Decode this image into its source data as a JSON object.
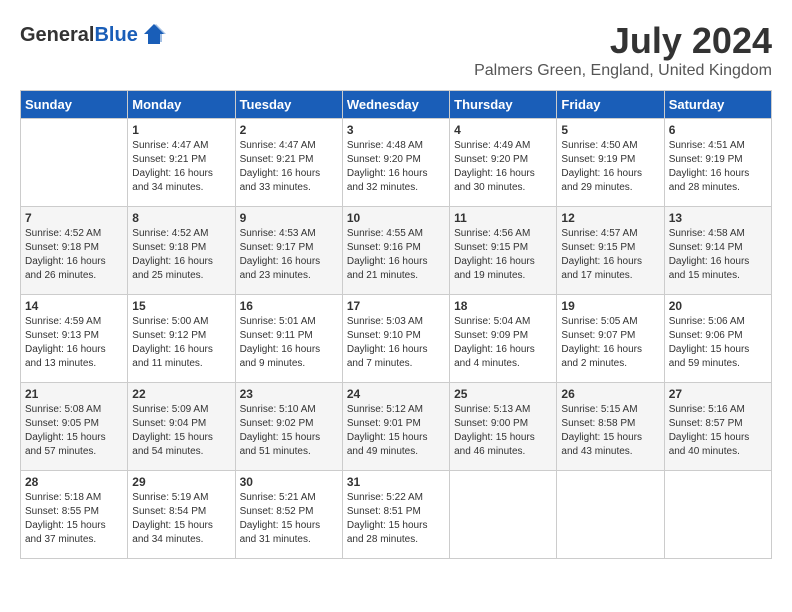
{
  "header": {
    "logo_general": "General",
    "logo_blue": "Blue",
    "month_year": "July 2024",
    "location": "Palmers Green, England, United Kingdom"
  },
  "calendar": {
    "days_of_week": [
      "Sunday",
      "Monday",
      "Tuesday",
      "Wednesday",
      "Thursday",
      "Friday",
      "Saturday"
    ],
    "weeks": [
      [
        {
          "day": "",
          "sunrise": "",
          "sunset": "",
          "daylight": ""
        },
        {
          "day": "1",
          "sunrise": "Sunrise: 4:47 AM",
          "sunset": "Sunset: 9:21 PM",
          "daylight": "Daylight: 16 hours and 34 minutes."
        },
        {
          "day": "2",
          "sunrise": "Sunrise: 4:47 AM",
          "sunset": "Sunset: 9:21 PM",
          "daylight": "Daylight: 16 hours and 33 minutes."
        },
        {
          "day": "3",
          "sunrise": "Sunrise: 4:48 AM",
          "sunset": "Sunset: 9:20 PM",
          "daylight": "Daylight: 16 hours and 32 minutes."
        },
        {
          "day": "4",
          "sunrise": "Sunrise: 4:49 AM",
          "sunset": "Sunset: 9:20 PM",
          "daylight": "Daylight: 16 hours and 30 minutes."
        },
        {
          "day": "5",
          "sunrise": "Sunrise: 4:50 AM",
          "sunset": "Sunset: 9:19 PM",
          "daylight": "Daylight: 16 hours and 29 minutes."
        },
        {
          "day": "6",
          "sunrise": "Sunrise: 4:51 AM",
          "sunset": "Sunset: 9:19 PM",
          "daylight": "Daylight: 16 hours and 28 minutes."
        }
      ],
      [
        {
          "day": "7",
          "sunrise": "Sunrise: 4:52 AM",
          "sunset": "Sunset: 9:18 PM",
          "daylight": "Daylight: 16 hours and 26 minutes."
        },
        {
          "day": "8",
          "sunrise": "Sunrise: 4:52 AM",
          "sunset": "Sunset: 9:18 PM",
          "daylight": "Daylight: 16 hours and 25 minutes."
        },
        {
          "day": "9",
          "sunrise": "Sunrise: 4:53 AM",
          "sunset": "Sunset: 9:17 PM",
          "daylight": "Daylight: 16 hours and 23 minutes."
        },
        {
          "day": "10",
          "sunrise": "Sunrise: 4:55 AM",
          "sunset": "Sunset: 9:16 PM",
          "daylight": "Daylight: 16 hours and 21 minutes."
        },
        {
          "day": "11",
          "sunrise": "Sunrise: 4:56 AM",
          "sunset": "Sunset: 9:15 PM",
          "daylight": "Daylight: 16 hours and 19 minutes."
        },
        {
          "day": "12",
          "sunrise": "Sunrise: 4:57 AM",
          "sunset": "Sunset: 9:15 PM",
          "daylight": "Daylight: 16 hours and 17 minutes."
        },
        {
          "day": "13",
          "sunrise": "Sunrise: 4:58 AM",
          "sunset": "Sunset: 9:14 PM",
          "daylight": "Daylight: 16 hours and 15 minutes."
        }
      ],
      [
        {
          "day": "14",
          "sunrise": "Sunrise: 4:59 AM",
          "sunset": "Sunset: 9:13 PM",
          "daylight": "Daylight: 16 hours and 13 minutes."
        },
        {
          "day": "15",
          "sunrise": "Sunrise: 5:00 AM",
          "sunset": "Sunset: 9:12 PM",
          "daylight": "Daylight: 16 hours and 11 minutes."
        },
        {
          "day": "16",
          "sunrise": "Sunrise: 5:01 AM",
          "sunset": "Sunset: 9:11 PM",
          "daylight": "Daylight: 16 hours and 9 minutes."
        },
        {
          "day": "17",
          "sunrise": "Sunrise: 5:03 AM",
          "sunset": "Sunset: 9:10 PM",
          "daylight": "Daylight: 16 hours and 7 minutes."
        },
        {
          "day": "18",
          "sunrise": "Sunrise: 5:04 AM",
          "sunset": "Sunset: 9:09 PM",
          "daylight": "Daylight: 16 hours and 4 minutes."
        },
        {
          "day": "19",
          "sunrise": "Sunrise: 5:05 AM",
          "sunset": "Sunset: 9:07 PM",
          "daylight": "Daylight: 16 hours and 2 minutes."
        },
        {
          "day": "20",
          "sunrise": "Sunrise: 5:06 AM",
          "sunset": "Sunset: 9:06 PM",
          "daylight": "Daylight: 15 hours and 59 minutes."
        }
      ],
      [
        {
          "day": "21",
          "sunrise": "Sunrise: 5:08 AM",
          "sunset": "Sunset: 9:05 PM",
          "daylight": "Daylight: 15 hours and 57 minutes."
        },
        {
          "day": "22",
          "sunrise": "Sunrise: 5:09 AM",
          "sunset": "Sunset: 9:04 PM",
          "daylight": "Daylight: 15 hours and 54 minutes."
        },
        {
          "day": "23",
          "sunrise": "Sunrise: 5:10 AM",
          "sunset": "Sunset: 9:02 PM",
          "daylight": "Daylight: 15 hours and 51 minutes."
        },
        {
          "day": "24",
          "sunrise": "Sunrise: 5:12 AM",
          "sunset": "Sunset: 9:01 PM",
          "daylight": "Daylight: 15 hours and 49 minutes."
        },
        {
          "day": "25",
          "sunrise": "Sunrise: 5:13 AM",
          "sunset": "Sunset: 9:00 PM",
          "daylight": "Daylight: 15 hours and 46 minutes."
        },
        {
          "day": "26",
          "sunrise": "Sunrise: 5:15 AM",
          "sunset": "Sunset: 8:58 PM",
          "daylight": "Daylight: 15 hours and 43 minutes."
        },
        {
          "day": "27",
          "sunrise": "Sunrise: 5:16 AM",
          "sunset": "Sunset: 8:57 PM",
          "daylight": "Daylight: 15 hours and 40 minutes."
        }
      ],
      [
        {
          "day": "28",
          "sunrise": "Sunrise: 5:18 AM",
          "sunset": "Sunset: 8:55 PM",
          "daylight": "Daylight: 15 hours and 37 minutes."
        },
        {
          "day": "29",
          "sunrise": "Sunrise: 5:19 AM",
          "sunset": "Sunset: 8:54 PM",
          "daylight": "Daylight: 15 hours and 34 minutes."
        },
        {
          "day": "30",
          "sunrise": "Sunrise: 5:21 AM",
          "sunset": "Sunset: 8:52 PM",
          "daylight": "Daylight: 15 hours and 31 minutes."
        },
        {
          "day": "31",
          "sunrise": "Sunrise: 5:22 AM",
          "sunset": "Sunset: 8:51 PM",
          "daylight": "Daylight: 15 hours and 28 minutes."
        },
        {
          "day": "",
          "sunrise": "",
          "sunset": "",
          "daylight": ""
        },
        {
          "day": "",
          "sunrise": "",
          "sunset": "",
          "daylight": ""
        },
        {
          "day": "",
          "sunrise": "",
          "sunset": "",
          "daylight": ""
        }
      ]
    ]
  }
}
